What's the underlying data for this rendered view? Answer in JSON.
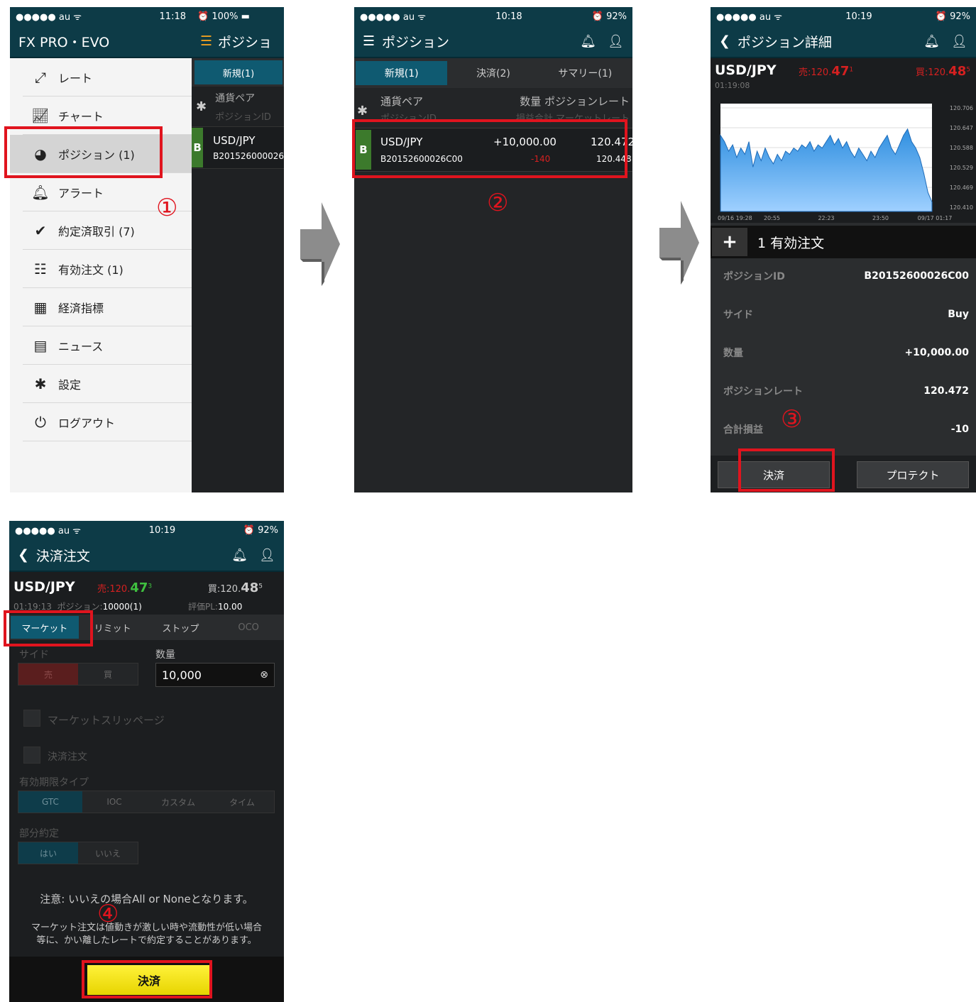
{
  "screen1": {
    "status": {
      "carrier": "●●●●● au ᯤ",
      "time": "11:18",
      "battery": "⏰ 100% ▬"
    },
    "app_title": "FX PRO・EVO",
    "menu": [
      {
        "label": "レート",
        "icon": "rate-icon"
      },
      {
        "label": "チャート",
        "icon": "chart-icon"
      },
      {
        "label": "ポジション (1)",
        "icon": "pie-icon"
      },
      {
        "label": "アラート",
        "icon": "bell-icon"
      },
      {
        "label": "約定済取引 (7)",
        "icon": "handshake-icon"
      },
      {
        "label": "有効注文 (1)",
        "icon": "list-icon"
      },
      {
        "label": "経済指標",
        "icon": "calendar-icon"
      },
      {
        "label": "ニュース",
        "icon": "news-icon"
      },
      {
        "label": "設定",
        "icon": "gear-icon"
      },
      {
        "label": "ログアウト",
        "icon": "power-icon"
      }
    ],
    "peek": {
      "title": "ポジショ",
      "tab": "新規(1)",
      "col1": "通貨ペア",
      "col2": "ポジションID",
      "pair": "USD/JPY",
      "id": "B201526000026",
      "side": "B"
    }
  },
  "screen2": {
    "status": {
      "carrier": "●●●●● au ᯤ",
      "time": "10:18",
      "battery": "⏰ 92%"
    },
    "title": "ポジション",
    "tabs": [
      "新規(1)",
      "決済(2)",
      "サマリー(1)"
    ],
    "col_pair": "通貨ペア",
    "col_qty_rate": "数量 ポジションレート",
    "col_id": "ポジションID",
    "col_pl_market": "損益合計 マーケットレート",
    "position": {
      "side": "B",
      "pair": "USD/JPY",
      "qty": "+10,000.00",
      "rate": "120.472",
      "id": "B20152600026C00",
      "pl": "-140",
      "market": "120.448"
    }
  },
  "screen3": {
    "status": {
      "carrier": "●●●●● au ᯤ",
      "time": "10:19",
      "battery": "⏰ 92%"
    },
    "title": "ポジション詳細",
    "pair": "USD/JPY",
    "time": "01:19:08",
    "sell": {
      "label": "売:",
      "main": "120.",
      "big": "47",
      "sup": "1"
    },
    "buy": {
      "label": "買:",
      "main": "120.",
      "big": "48",
      "sup": "5"
    },
    "chart_data": {
      "type": "area",
      "y_ticks": [
        "120.706",
        "120.647",
        "120.588",
        "120.529",
        "120.469",
        "120.410"
      ],
      "ylim": [
        120.38,
        120.72
      ],
      "x_ticks": [
        "09/16 19:28",
        "20:55",
        "22:23",
        "23:50",
        "09/17 01:17"
      ],
      "values": [
        120.62,
        120.6,
        120.57,
        120.59,
        120.55,
        120.58,
        120.56,
        120.6,
        120.52,
        120.57,
        120.54,
        120.58,
        120.55,
        120.53,
        120.56,
        120.54,
        120.57,
        120.56,
        120.58,
        120.57,
        120.59,
        120.58,
        120.6,
        120.57,
        120.59,
        120.58,
        120.6,
        120.62,
        120.59,
        120.61,
        120.58,
        120.6,
        120.57,
        120.55,
        120.58,
        120.56,
        120.54,
        120.57,
        120.55,
        120.58,
        120.6,
        120.62,
        120.58,
        120.56,
        120.59,
        120.62,
        120.64,
        120.6,
        120.58,
        120.55,
        120.5,
        120.44,
        120.41
      ]
    },
    "orders": "1 有効注文",
    "details": [
      {
        "k": "ポジションID",
        "v": "B20152600026C00"
      },
      {
        "k": "サイド",
        "v": "Buy"
      },
      {
        "k": "数量",
        "v": "+10,000.00"
      },
      {
        "k": "ポジションレート",
        "v": "120.472"
      },
      {
        "k": "合計損益",
        "v": "-10"
      }
    ],
    "btn_settle": "決済",
    "btn_protect": "プロテクト"
  },
  "screen4": {
    "status": {
      "carrier": "●●●●● au ᯤ",
      "time": "10:19",
      "battery": "⏰ 92%"
    },
    "title": "決済注文",
    "pair": "USD/JPY",
    "time": "01:19:13",
    "position_label": "ポジション:",
    "position_value": "10000(1)",
    "pl_label": "評価PL:",
    "pl_value": "10.00",
    "sell": {
      "label": "売:",
      "main": "120.",
      "big": "47",
      "sup": "3"
    },
    "buy": {
      "label": "買:",
      "main": "120.",
      "big": "48",
      "sup": "5"
    },
    "order_tabs": [
      "マーケット",
      "リミット",
      "ストップ",
      "OCO"
    ],
    "side_label": "サイド",
    "side_sell": "売",
    "side_buy": "買",
    "qty_label": "数量",
    "qty_value": "10,000",
    "slippage": "マーケットスリッページ",
    "settle_order": "決済注文",
    "validity_label": "有効期限タイプ",
    "validity": [
      "GTC",
      "IOC",
      "カスタム",
      "タイム"
    ],
    "partial_label": "部分約定",
    "partial": [
      "はい",
      "いいえ"
    ],
    "note1": "注意: いいえの場合All or Noneとなります。",
    "note2a": "マーケット注文は値動きが激しい時や流動性が低い場合",
    "note2b": "等に、かい離したレートで約定することがあります。",
    "submit": "決済"
  },
  "steps": [
    "①",
    "②",
    "③",
    "④"
  ]
}
